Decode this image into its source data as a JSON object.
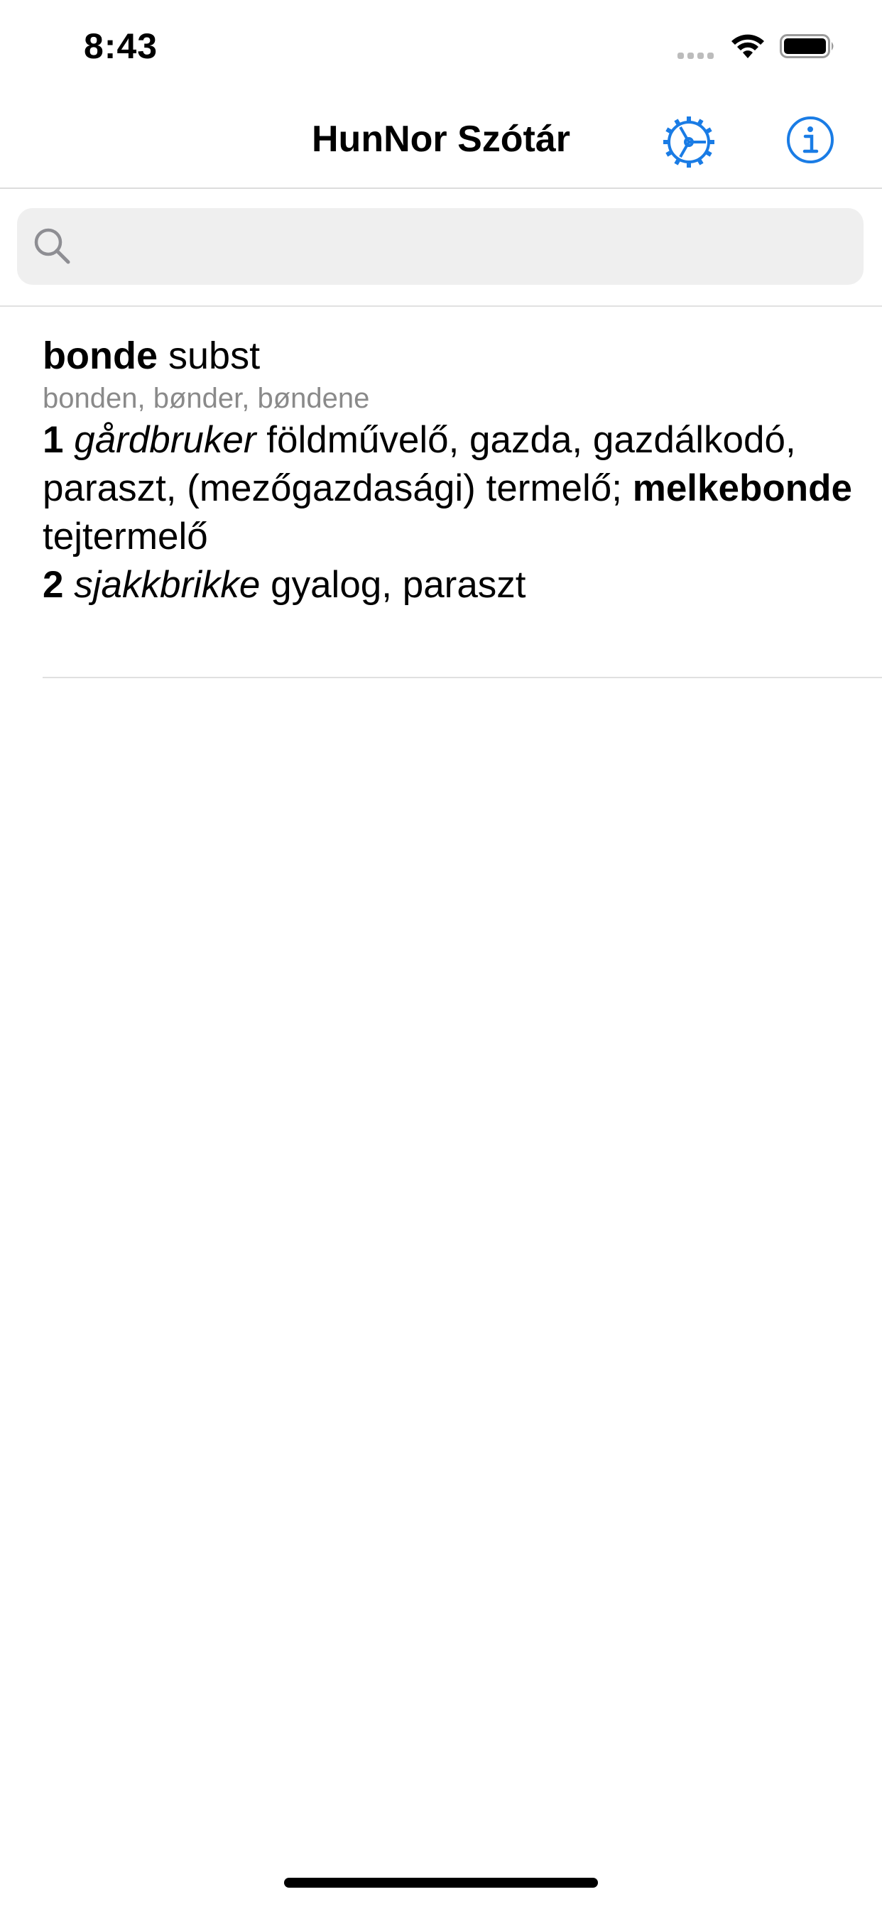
{
  "status_bar": {
    "time": "8:43",
    "icons": [
      "signal-dots-icon",
      "wifi-icon",
      "battery-icon"
    ]
  },
  "nav": {
    "title": "HunNor Szótár",
    "settings_icon": "gear-icon",
    "info_icon": "info-icon",
    "accent_color": "#1a7ce5"
  },
  "search": {
    "placeholder": "",
    "value": "",
    "icon": "search-icon"
  },
  "entry": {
    "headword": "bonde",
    "pos": "subst",
    "forms": "bonden, bønder, bøndene",
    "senses": [
      {
        "number": "1",
        "label": "gårdbruker",
        "translation": "földművelő, gazda, gazdálkodó, paraszt, (mezőgazdasági) termelő;",
        "example_word": "melkebonde",
        "example_translation": "tejtermelő"
      },
      {
        "number": "2",
        "label": "sjakkbrikke",
        "translation": "gyalog, paraszt"
      }
    ]
  }
}
